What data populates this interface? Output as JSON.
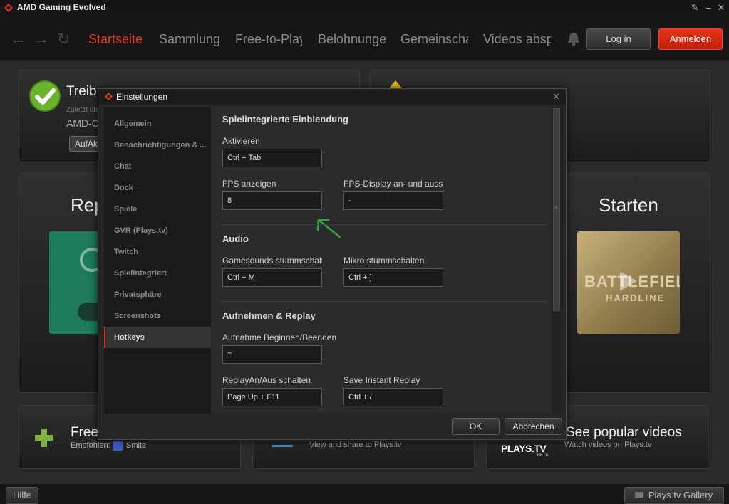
{
  "app": {
    "title": "AMD Gaming Evolved"
  },
  "nav": {
    "items": [
      "Startseite",
      "Sammlung",
      "Free-to-Play",
      "Belohnungen",
      "Gemeinschaft",
      "Videos abspielen"
    ],
    "login": "Log in",
    "signup": "Anmelden"
  },
  "background": {
    "driver_title": "Treib",
    "driver_sub": "Zuletzt üb",
    "driver_device": "AMD-C",
    "driver_button": "AufAk",
    "replay_title": "Rep",
    "start_title": "Starten",
    "free_title": "Free",
    "recommended_label": "Empfohlen:",
    "recommended_game": "Smite",
    "share_sub": "View and share to Plays.tv",
    "popular_title": "See popular videos",
    "popular_sub": "Watch videos on Plays.tv",
    "plays_logo": "PLAYS.TV",
    "plays_beta": "BETA",
    "game_logo_line1": "BATTLEFIELD",
    "game_logo_line2": "HARDLINE"
  },
  "footer": {
    "help": "Hilfe",
    "gallery": "Plays.tv Gallery"
  },
  "dialog": {
    "title": "Einstellungen",
    "sidebar": [
      "Allgemein",
      "Benachrichtigungen & ...",
      "Chat",
      "Dock",
      "Spiele",
      "GVR (Plays.tv)",
      "Twitch",
      "Spielintegriert",
      "Privatsphäre",
      "Screenshots",
      "Hotkeys"
    ],
    "active_item": "Hotkeys",
    "sections": {
      "overlay": "Spielintegrierte Einblendung",
      "audio": "Audio",
      "record": "Aufnehmen & Replay"
    },
    "fields": {
      "activate_label": "Aktivieren",
      "activate_value": "Ctrl + Tab",
      "fps_label": "FPS anzeigen",
      "fps_value": "8",
      "fps_display_label": "FPS-Display an- und ausschalten",
      "fps_display_value": "-",
      "gamesound_label": "Gamesounds stummschalten",
      "gamesound_value": "Ctrl + M",
      "mic_label": "Mikro stummschalten",
      "mic_value": "Ctrl + ]",
      "record_label": "Aufnahme Beginnen/Beenden",
      "record_value": "=",
      "replay_toggle_label": "ReplayAn/Aus schalten",
      "replay_toggle_value": "Page Up + F11",
      "instant_replay_label": "Save Instant Replay",
      "instant_replay_value": "Ctrl + /"
    },
    "ok": "OK",
    "cancel": "Abbrechen"
  },
  "colors": {
    "accent": "#e0351c",
    "check_green": "#6bb32a",
    "annotation_green": "#2fa84a"
  }
}
